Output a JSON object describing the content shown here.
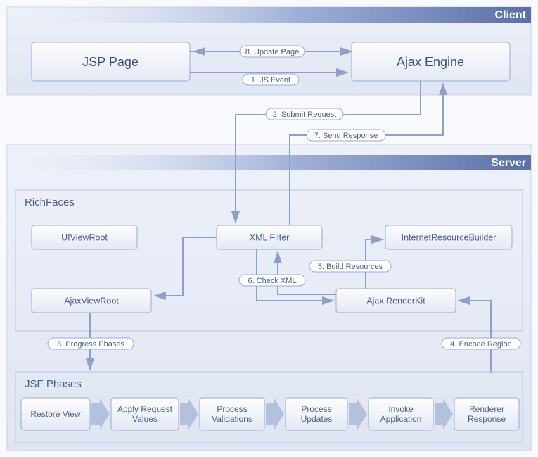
{
  "panels": {
    "client": "Client",
    "server": "Server"
  },
  "sections": {
    "richfaces": "RichFaces",
    "jsfphases": "JSF Phases"
  },
  "boxes": {
    "jsp_page": "JSP Page",
    "ajax_engine": "Ajax Engine",
    "uiviewroot": "UIViewRoot",
    "xml_filter": "XML Filter",
    "irb": "InternetResourceBuilder",
    "ajaxviewroot": "AjaxViewRoot",
    "ajax_renderkit": "Ajax RenderKit"
  },
  "phases": [
    "Restore View",
    "Apply Request Values",
    "Process Validations",
    "Process Updates",
    "Invoke Application",
    "Renderer Response"
  ],
  "edges": {
    "e1": "1. JS Event",
    "e2": "2. Submit Request",
    "e3": "3. Progress Phases",
    "e4": "4. Encode Region",
    "e5": "5. Build Resources",
    "e6": "6. Check XML",
    "e7": "7. Send Response",
    "e8": "8. Update Page"
  }
}
